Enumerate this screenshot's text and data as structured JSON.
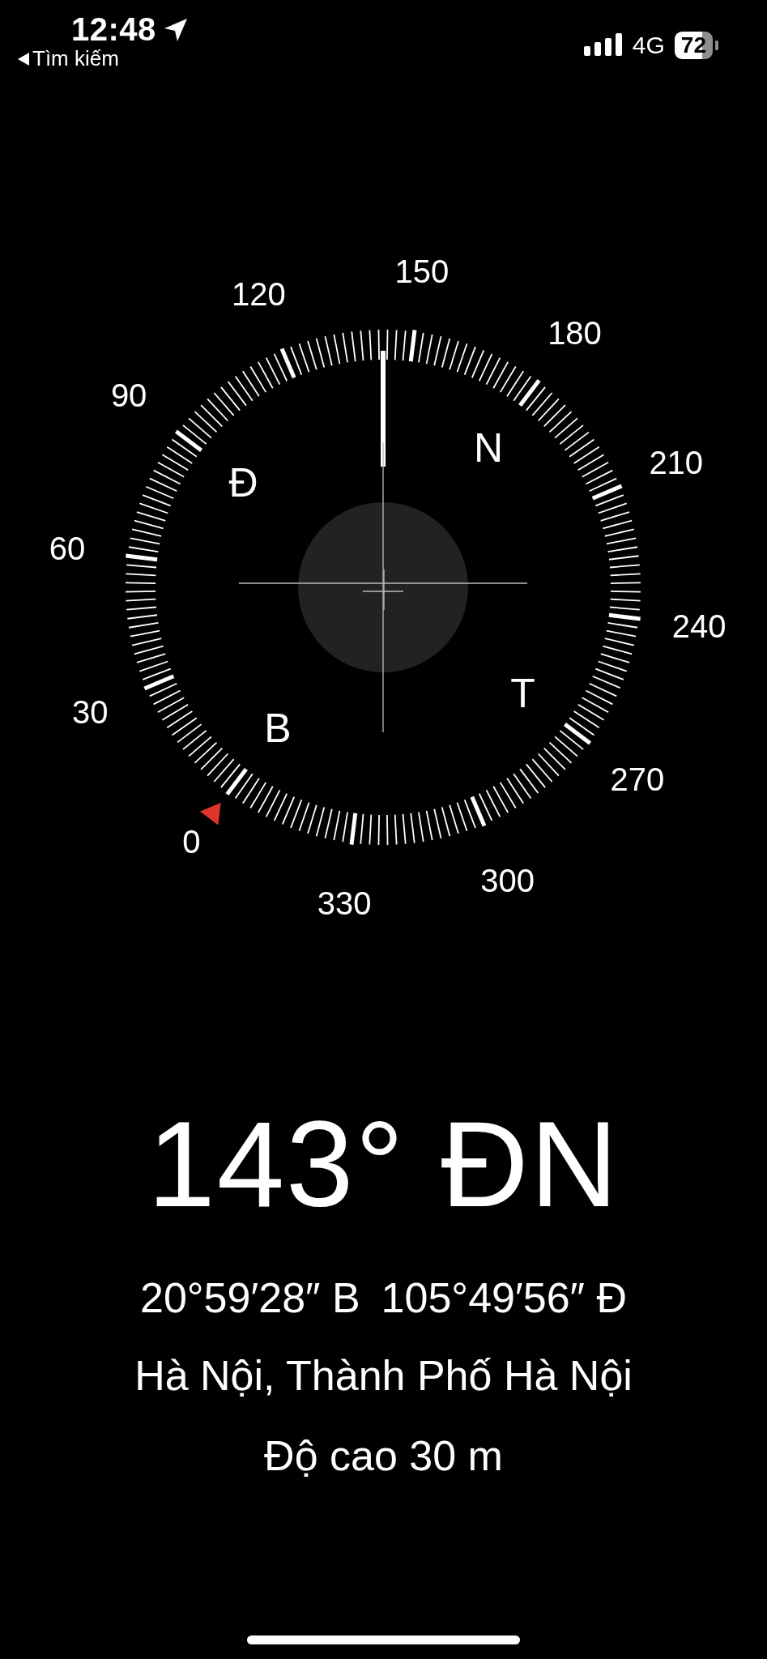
{
  "status_bar": {
    "time": "12:48",
    "back_label": "Tìm kiếm",
    "network": "4G",
    "battery": "72"
  },
  "compass": {
    "dial_numbers": [
      "0",
      "30",
      "60",
      "90",
      "120",
      "150",
      "180",
      "210",
      "240",
      "270",
      "300",
      "330"
    ],
    "cardinals": [
      "B",
      "Đ",
      "N",
      "T"
    ]
  },
  "readout": {
    "heading": "143° ĐN",
    "latitude": "20°59′28″ B",
    "longitude": "105°49′56″ Đ",
    "place": "Hà Nội, Thành Phố Hà Nội",
    "altitude": "Độ cao 30 m"
  }
}
